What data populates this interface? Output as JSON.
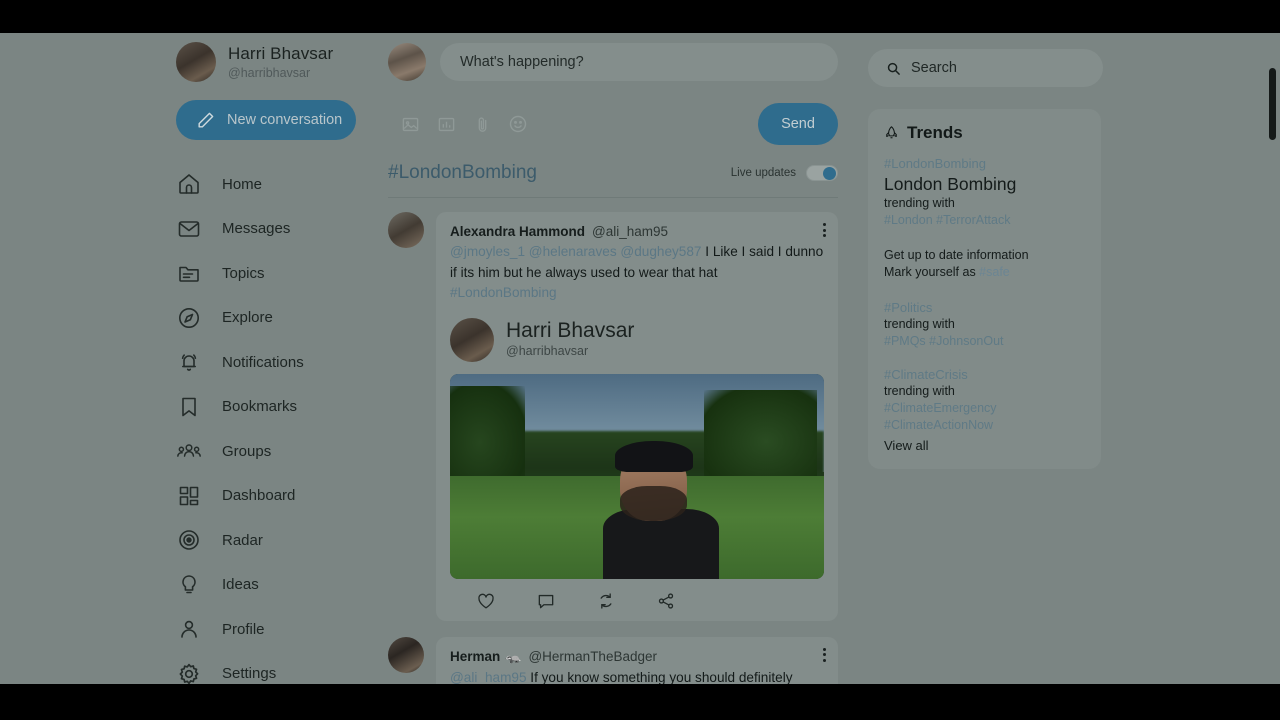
{
  "app": {
    "background_color": "#7b8583",
    "accent_color": "#2f6c8d",
    "link_color": "#5b7785"
  },
  "sidebar": {
    "profile": {
      "name": "Harri Bhavsar",
      "handle": "@harribhavsar",
      "avatar_name": "user-avatar"
    },
    "new_conversation_label": "New conversation",
    "items": [
      {
        "label": "Home",
        "icon": "home-icon"
      },
      {
        "label": "Messages",
        "icon": "envelope-icon"
      },
      {
        "label": "Topics",
        "icon": "folder-list-icon"
      },
      {
        "label": "Explore",
        "icon": "compass-icon"
      },
      {
        "label": "Notifications",
        "icon": "bell-icon"
      },
      {
        "label": "Bookmarks",
        "icon": "bookmark-icon"
      },
      {
        "label": "Groups",
        "icon": "people-group-icon"
      },
      {
        "label": "Dashboard",
        "icon": "dashboard-grid-icon"
      },
      {
        "label": "Radar",
        "icon": "radar-target-icon"
      },
      {
        "label": "Ideas",
        "icon": "lightbulb-icon"
      },
      {
        "label": "Profile",
        "icon": "person-icon"
      },
      {
        "label": "Settings",
        "icon": "gear-icon"
      }
    ]
  },
  "composer": {
    "placeholder": "What's happening?",
    "value": "",
    "tools": [
      {
        "icon": "image-icon"
      },
      {
        "icon": "poll-chart-icon"
      },
      {
        "icon": "paperclip-icon"
      },
      {
        "icon": "emoji-smiley-icon"
      }
    ],
    "send_label": "Send"
  },
  "feed_header": {
    "topic": "#LondonBombing",
    "live_updates_label": "Live updates",
    "live_updates_on": true
  },
  "posts": [
    {
      "author_name": "Alexandra Hammond",
      "author_handle": "@ali_ham95",
      "avatar_name": "post-avatar-alexandra",
      "mentions": "@jmoyles_1 @helenaraves @dughey587",
      "text": " I Like I said I dunno if its him but he always used to wear that hat ",
      "hashtag": "#LondonBombing",
      "more_icon": "more-vertical-icon",
      "quote": {
        "name": "Harri Bhavsar",
        "handle": "@harribhavsar",
        "avatar_name": "quote-avatar-harri",
        "image_alt": "man-in-backwards-cap-in-park-photo"
      },
      "actions": [
        {
          "icon": "heart-like-icon"
        },
        {
          "icon": "comment-icon"
        },
        {
          "icon": "repost-icon"
        },
        {
          "icon": "share-icon"
        }
      ]
    },
    {
      "author_name": "Herman",
      "author_badge": "badger-emoji",
      "author_handle": "@HermanTheBadger",
      "avatar_name": "post-avatar-herman",
      "mentions": "@ali_ham95",
      "text": " If you know something you should definitely",
      "more_icon": "more-vertical-icon"
    }
  ],
  "search": {
    "placeholder": "Search",
    "value": "",
    "icon": "search-icon"
  },
  "trends": {
    "title": "Trends",
    "icon": "rocket-icon",
    "items": [
      {
        "tag": "#LondonBombing",
        "name": "London Bombing",
        "sub": "trending with",
        "related": "#London #TerrorAttack"
      },
      {
        "info_line_1": "Get up to date information",
        "info_line_2_prefix": "Mark yourself as ",
        "info_line_2_tag": "#safe"
      },
      {
        "tag": "#Politics",
        "sub": "trending with",
        "related": "#PMQs #JohnsonOut"
      },
      {
        "tag": "#ClimateCrisis",
        "sub": "trending with",
        "related_1": "#ClimateEmergency",
        "related_2": "#ClimateActionNow"
      }
    ],
    "view_all_label": "View all"
  }
}
